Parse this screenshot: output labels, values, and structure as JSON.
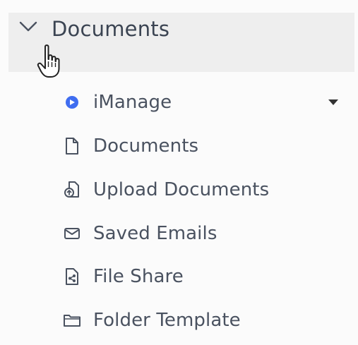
{
  "section": {
    "title": "Documents",
    "expanded": true
  },
  "items": [
    {
      "label": "iManage",
      "icon": "imanage-icon",
      "has_dropdown": true
    },
    {
      "label": "Documents",
      "icon": "document-icon"
    },
    {
      "label": "Upload Documents",
      "icon": "upload-documents-icon"
    },
    {
      "label": "Saved Emails",
      "icon": "email-icon"
    },
    {
      "label": "File Share",
      "icon": "file-share-icon"
    },
    {
      "label": "Folder Template",
      "icon": "folder-icon"
    }
  ],
  "colors": {
    "header_bg": "#eeeeee",
    "text": "#4a5260",
    "title_text": "#3b4452",
    "imanage_accent": "#3f6df0"
  }
}
